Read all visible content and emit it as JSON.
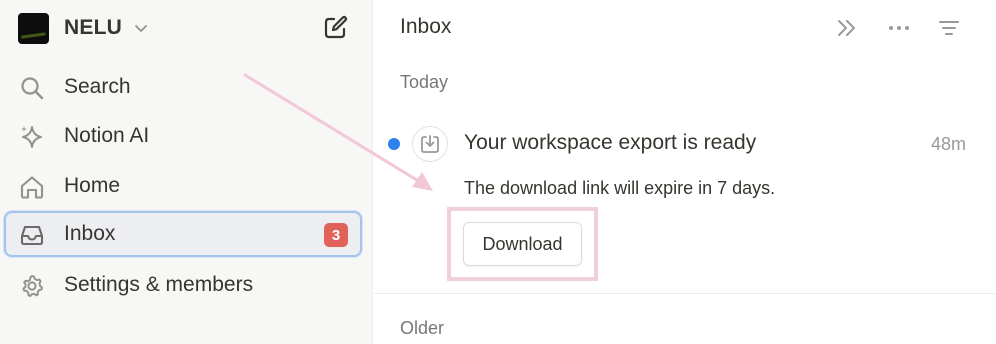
{
  "sidebar": {
    "workspace_name": "NELU",
    "items": [
      {
        "label": "Search",
        "icon": "search-icon"
      },
      {
        "label": "Notion AI",
        "icon": "sparkle-icon"
      },
      {
        "label": "Home",
        "icon": "home-icon"
      },
      {
        "label": "Inbox",
        "icon": "inbox-icon",
        "badge": "3",
        "active": true
      },
      {
        "label": "Settings & members",
        "icon": "gear-icon"
      }
    ]
  },
  "main": {
    "title": "Inbox",
    "sections": {
      "today": "Today",
      "older": "Older"
    },
    "notification": {
      "title": "Your workspace export is ready",
      "time": "48m",
      "description": "The download link will expire in 7 days.",
      "button_label": "Download",
      "unread": true
    }
  },
  "colors": {
    "unread_dot": "#2f80ed",
    "badge": "#e16259",
    "active_border": "#a5c4ec",
    "annotation": "#f1d0dc"
  }
}
